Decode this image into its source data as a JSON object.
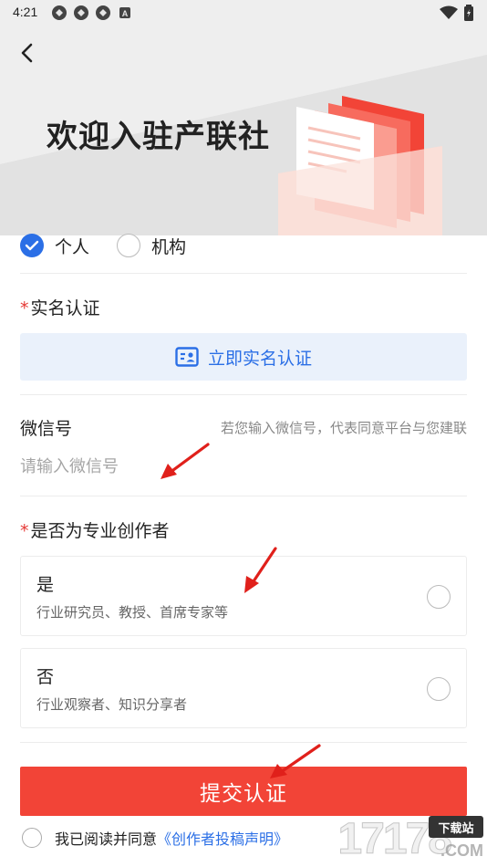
{
  "status_bar": {
    "time": "4:21",
    "icons": [
      "app-icon",
      "app-icon",
      "app-icon",
      "a-badge-icon"
    ],
    "right_icons": [
      "wifi-icon",
      "battery-icon"
    ]
  },
  "header": {
    "title": "欢迎入驻产联社"
  },
  "identity_type": {
    "options": [
      {
        "label": "个人",
        "selected": true
      },
      {
        "label": "机构",
        "selected": false
      }
    ]
  },
  "real_name": {
    "label": "实名认证",
    "required_mark": "*",
    "button_label": "立即实名认证"
  },
  "wechat": {
    "label": "微信号",
    "hint": "若您输入微信号，代表同意平台与您建联",
    "placeholder": "请输入微信号",
    "value": ""
  },
  "creator": {
    "label": "是否为专业创作者",
    "required_mark": "*",
    "choices": [
      {
        "title": "是",
        "desc": "行业研究员、教授、首席专家等",
        "selected": false
      },
      {
        "title": "否",
        "desc": "行业观察者、知识分享者",
        "selected": false
      }
    ]
  },
  "submit": {
    "label": "提交认证"
  },
  "agreement": {
    "prefix": "我已阅读并同意",
    "link": "《创作者投稿声明》",
    "checked": false
  },
  "watermark": {
    "text": "17178",
    "badge": "下载站",
    "suffix": ".COM"
  },
  "colors": {
    "primary_blue": "#2b6fe6",
    "submit_red": "#f24437",
    "required_red": "#e53935",
    "hero_bg": "#e6e6e6",
    "annotation_arrow": "#e0201b"
  }
}
